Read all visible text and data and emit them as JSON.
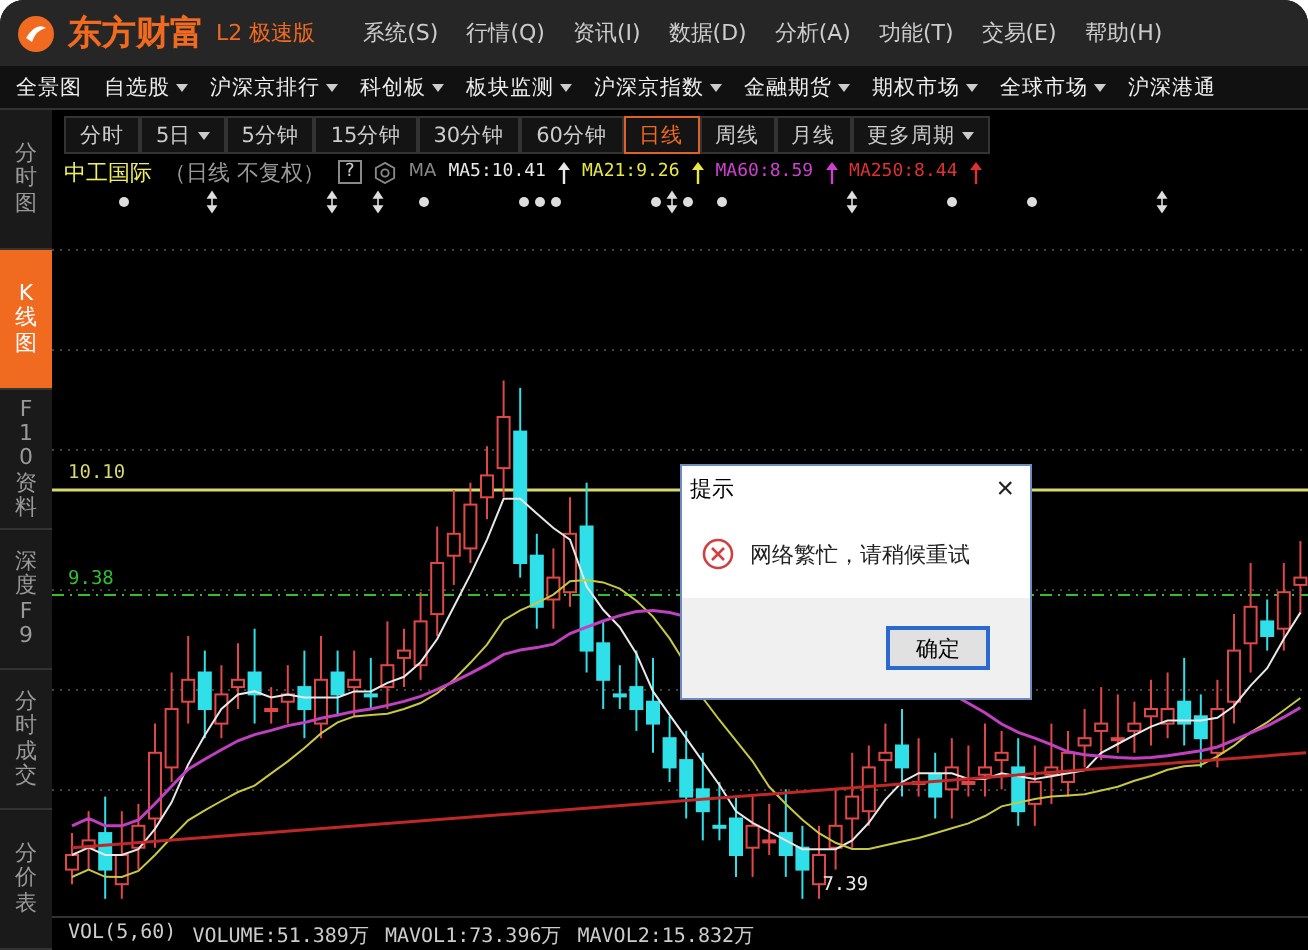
{
  "title_bar": {
    "logo": "东方财富",
    "edition": "L2 极速版",
    "menu": [
      "系统(S)",
      "行情(Q)",
      "资讯(I)",
      "数据(D)",
      "分析(A)",
      "功能(T)",
      "交易(E)",
      "帮助(H)"
    ]
  },
  "nav_bar": [
    {
      "label": "全景图",
      "dropdown": false
    },
    {
      "label": "自选股",
      "dropdown": true
    },
    {
      "label": "沪深京排行",
      "dropdown": true
    },
    {
      "label": "科创板",
      "dropdown": true
    },
    {
      "label": "板块监测",
      "dropdown": true
    },
    {
      "label": "沪深京指数",
      "dropdown": true
    },
    {
      "label": "金融期货",
      "dropdown": true
    },
    {
      "label": "期权市场",
      "dropdown": true
    },
    {
      "label": "全球市场",
      "dropdown": true
    },
    {
      "label": "沪深港通",
      "dropdown": false
    }
  ],
  "sidebar": [
    {
      "label": "分时图",
      "selected": false
    },
    {
      "label": "K线图",
      "selected": true
    },
    {
      "label": "F10资料",
      "selected": false
    },
    {
      "label": "深度F9",
      "selected": false
    },
    {
      "label": "分时成交",
      "selected": false
    },
    {
      "label": "分价表",
      "selected": false
    }
  ],
  "period_tabs": [
    {
      "label": "分时",
      "dropdown": false,
      "selected": false
    },
    {
      "label": "5日",
      "dropdown": true,
      "selected": false
    },
    {
      "label": "5分钟",
      "dropdown": false,
      "selected": false
    },
    {
      "label": "15分钟",
      "dropdown": false,
      "selected": false
    },
    {
      "label": "30分钟",
      "dropdown": false,
      "selected": false
    },
    {
      "label": "60分钟",
      "dropdown": false,
      "selected": false
    },
    {
      "label": "日线",
      "dropdown": false,
      "selected": true
    },
    {
      "label": "周线",
      "dropdown": false,
      "selected": false
    },
    {
      "label": "月线",
      "dropdown": false,
      "selected": false
    },
    {
      "label": "更多周期",
      "dropdown": true,
      "selected": false
    }
  ],
  "chart_header": {
    "stock": "中工国际",
    "mode": "（日线 不复权）",
    "help": "?",
    "ma_label": "MA",
    "indicators": [
      {
        "text": "MA5:10.41",
        "color": "#e8e8e8"
      },
      {
        "text": "MA21:9.26",
        "color": "#e8e840"
      },
      {
        "text": "MA60:8.59",
        "color": "#d040d0"
      },
      {
        "text": "MA250:8.44",
        "color": "#e03030"
      }
    ]
  },
  "price_labels": [
    {
      "text": "10.10",
      "kind": "line",
      "color": "#d8d870"
    },
    {
      "text": "9.38",
      "kind": "dashed",
      "color": "#30c030"
    },
    {
      "text": "7.39",
      "kind": "low",
      "color": "#e8e8e8"
    }
  ],
  "volume_header": [
    "VOL(5,60)",
    "VOLUME:51.389万",
    "MAVOL1:73.396万",
    "MAVOL2:15.832万"
  ],
  "dialog": {
    "title": "提示",
    "close": "×",
    "message": "网络繁忙，请稍候重试",
    "button": "确定"
  }
}
